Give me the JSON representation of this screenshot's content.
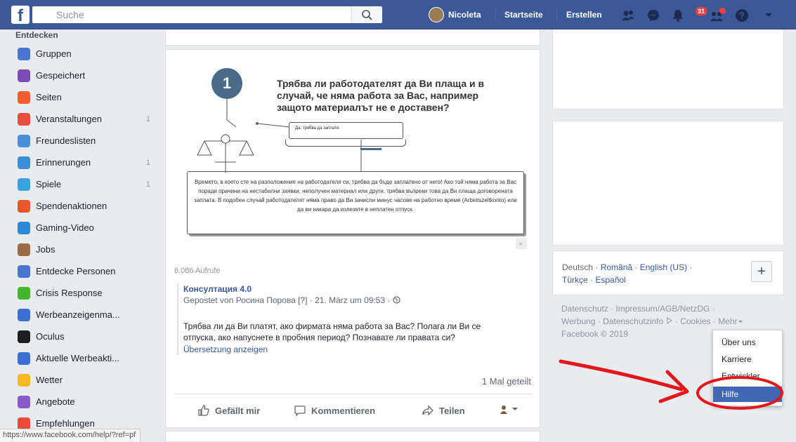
{
  "topbar": {
    "logo": "f",
    "search_placeholder": "Suche",
    "user_name": "Nicoleta",
    "home_label": "Startseite",
    "create_label": "Erstellen",
    "notification_count": "31"
  },
  "leftnav": {
    "header": "Entdecken",
    "items": [
      {
        "label": "Gruppen",
        "icon": "groups-icon",
        "color": "#4a76cf",
        "count": ""
      },
      {
        "label": "Gespeichert",
        "icon": "bookmark-icon",
        "color": "#7b4bb6",
        "count": ""
      },
      {
        "label": "Seiten",
        "icon": "flag-icon",
        "color": "#f25e2f",
        "count": ""
      },
      {
        "label": "Veranstaltungen",
        "icon": "calendar-icon",
        "color": "#e74c3c",
        "count": "1"
      },
      {
        "label": "Freundeslisten",
        "icon": "friends-list-icon",
        "color": "#4a90d9",
        "count": ""
      },
      {
        "label": "Erinnerungen",
        "icon": "memories-icon",
        "color": "#3b8fd6",
        "count": "1"
      },
      {
        "label": "Spiele",
        "icon": "gamepad-icon",
        "color": "#36a3de",
        "count": "1"
      },
      {
        "label": "Spendenaktionen",
        "icon": "fundraiser-icon",
        "color": "#e9572d",
        "count": ""
      },
      {
        "label": "Gaming-Video",
        "icon": "gaming-video-icon",
        "color": "#2d88d6",
        "count": ""
      },
      {
        "label": "Jobs",
        "icon": "briefcase-icon",
        "color": "#9b6b45",
        "count": ""
      },
      {
        "label": "Entdecke Personen",
        "icon": "discover-people-icon",
        "color": "#4a76cf",
        "count": ""
      },
      {
        "label": "Crisis Response",
        "icon": "crisis-response-icon",
        "color": "#42b72a",
        "count": ""
      },
      {
        "label": "Werbeanzeigenma...",
        "icon": "ads-manager-icon",
        "color": "#3b6fd6",
        "count": ""
      },
      {
        "label": "Oculus",
        "icon": "oculus-icon",
        "color": "#1c1e21",
        "count": ""
      },
      {
        "label": "Aktuelle Werbeakti...",
        "icon": "recent-ads-icon",
        "color": "#3b6fd6",
        "count": ""
      },
      {
        "label": "Wetter",
        "icon": "weather-icon",
        "color": "#f7b928",
        "count": ""
      },
      {
        "label": "Angebote",
        "icon": "offers-icon",
        "color": "#8a5ac9",
        "count": ""
      },
      {
        "label": "Empfehlungen",
        "icon": "recommendations-icon",
        "color": "#e74c3c",
        "count": ""
      }
    ]
  },
  "post": {
    "question": "Трябва ли работодателят да Ви плаща и в случай, че няма работа за Вас, например защото материалът не е доставен?",
    "step_number": "1",
    "answer": "Да, трябва да заплати.",
    "explanation": "Времето, в което сте на разположение на работодателя си, трябва да бъде заплатено от него! Ако той няма работа за Вас поради причини на нестабилни заявки, неполучен материал или други, трябва въпреки това да Ви плаща договорената заплата. В подобен случай работодателят няма право да Ви зачисли минус часове на работно време (Arbeitszeitkonto) или да ви накара да излезете в неплатен отпуск.",
    "views": "6.086 Aufrufe",
    "title": "Консултация 4.0",
    "posted_by": "Gepostet von Росина Порова [?] · 21. März um 09:53 · ",
    "body": "Трябва ли да Ви платят, ако фирмата няма работа за Вас? Полага ли Ви се отпуска, ако напуснете в пробния период? Познавате ли правата си?",
    "translate": "Übersetzung anzeigen",
    "shares": "1 Mal geteilt",
    "like": "Gefällt mir",
    "comment": "Kommentieren",
    "share": "Teilen"
  },
  "languages": {
    "items": [
      "Deutsch",
      "Română",
      "English (US)",
      "Türkçe",
      "Español"
    ]
  },
  "footer": {
    "line1": "Datenschutz · Impressum/AGB/NetzDG ·",
    "line2a": "Werbung · Datenschutzinfo ",
    "line2b": " · Cookies · Mehr",
    "copyright": "Facebook © 2019"
  },
  "menu": {
    "items": [
      "Über uns",
      "Karriere",
      "Entwickler",
      "Hilfe"
    ]
  },
  "status_url": "https://www.facebook.com/help/?ref=pf"
}
